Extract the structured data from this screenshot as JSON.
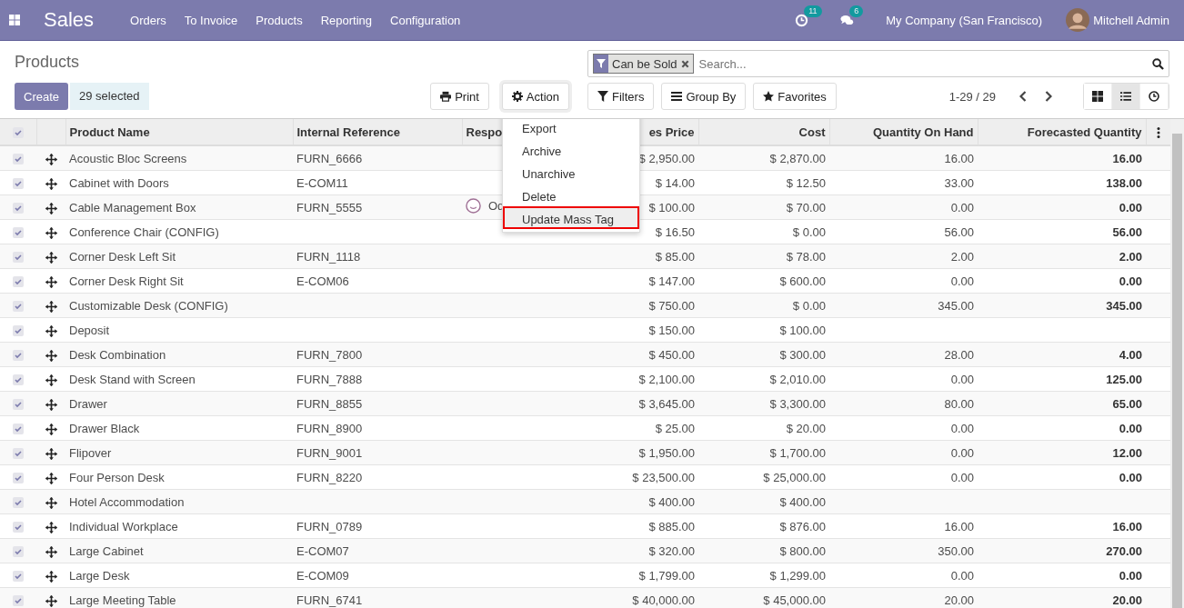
{
  "navbar": {
    "app": "Sales",
    "menu": [
      "Orders",
      "To Invoice",
      "Products",
      "Reporting",
      "Configuration"
    ],
    "activity_count": "11",
    "message_count": "6",
    "company": "My Company (San Francisco)",
    "user": "Mitchell Admin"
  },
  "control_panel": {
    "title": "Products",
    "create": "Create",
    "selection": "29 selected",
    "print": "Print",
    "action": "Action",
    "facet": {
      "label": "Can be Sold"
    },
    "search": {
      "placeholder": "Search..."
    },
    "filters": "Filters",
    "group_by": "Group By",
    "favorites": "Favorites",
    "pager": "1-29 / 29",
    "views": [
      {
        "kind": "kanban",
        "selected": false
      },
      {
        "kind": "list",
        "selected": true
      },
      {
        "kind": "activity",
        "selected": false
      }
    ]
  },
  "action_menu": [
    {
      "label": "Export",
      "selected": false
    },
    {
      "label": "Archive",
      "selected": false
    },
    {
      "label": "Unarchive",
      "selected": false
    },
    {
      "label": "Delete",
      "selected": false
    },
    {
      "label": "Update Mass Tag",
      "selected": true
    }
  ],
  "table": {
    "all_checked": true,
    "columns": [
      "Product Name",
      "Internal Reference",
      "Respo",
      "es Price",
      "Cost",
      "Quantity On Hand",
      "Forecasted Quantity"
    ],
    "rows": [
      {
        "checked": true,
        "name": "Acoustic Bloc Screens",
        "ref": "FURN_6666",
        "price": "$ 2,950.00",
        "cost": "$ 2,870.00",
        "on_hand": "16.00",
        "forecast": "16.00"
      },
      {
        "checked": true,
        "name": "Cabinet with Doors",
        "ref": "E-COM11",
        "price": "$ 14.00",
        "cost": "$ 12.50",
        "on_hand": "33.00",
        "forecast": "138.00"
      },
      {
        "checked": true,
        "name": "Cable Management Box",
        "ref": "FURN_5555",
        "responsible": "Od",
        "price": "$ 100.00",
        "cost": "$ 70.00",
        "on_hand": "0.00",
        "forecast": "0.00"
      },
      {
        "checked": true,
        "name": "Conference Chair (CONFIG)",
        "price": "$ 16.50",
        "cost": "$ 0.00",
        "on_hand": "56.00",
        "forecast": "56.00"
      },
      {
        "checked": true,
        "name": "Corner Desk Left Sit",
        "ref": "FURN_1118",
        "price": "$ 85.00",
        "cost": "$ 78.00",
        "on_hand": "2.00",
        "forecast": "2.00"
      },
      {
        "checked": true,
        "name": "Corner Desk Right Sit",
        "ref": "E-COM06",
        "price": "$ 147.00",
        "cost": "$ 600.00",
        "on_hand": "0.00",
        "forecast": "0.00"
      },
      {
        "checked": true,
        "name": "Customizable Desk (CONFIG)",
        "price": "$ 750.00",
        "cost": "$ 0.00",
        "on_hand": "345.00",
        "forecast": "345.00"
      },
      {
        "checked": true,
        "name": "Deposit",
        "price": "$ 150.00",
        "cost": "$ 100.00"
      },
      {
        "checked": true,
        "name": "Desk Combination",
        "ref": "FURN_7800",
        "price": "$ 450.00",
        "cost": "$ 300.00",
        "on_hand": "28.00",
        "forecast": "4.00"
      },
      {
        "checked": true,
        "name": "Desk Stand with Screen",
        "ref": "FURN_7888",
        "price": "$ 2,100.00",
        "cost": "$ 2,010.00",
        "on_hand": "0.00",
        "forecast": "125.00"
      },
      {
        "checked": true,
        "name": "Drawer",
        "ref": "FURN_8855",
        "price": "$ 3,645.00",
        "cost": "$ 3,300.00",
        "on_hand": "80.00",
        "forecast": "65.00"
      },
      {
        "checked": true,
        "name": "Drawer Black",
        "ref": "FURN_8900",
        "price": "$ 25.00",
        "cost": "$ 20.00",
        "on_hand": "0.00",
        "forecast": "0.00"
      },
      {
        "checked": true,
        "name": "Flipover",
        "ref": "FURN_9001",
        "price": "$ 1,950.00",
        "cost": "$ 1,700.00",
        "on_hand": "0.00",
        "forecast": "12.00"
      },
      {
        "checked": true,
        "name": "Four Person Desk",
        "ref": "FURN_8220",
        "price": "$ 23,500.00",
        "cost": "$ 25,000.00",
        "on_hand": "0.00",
        "forecast": "0.00"
      },
      {
        "checked": true,
        "name": "Hotel Accommodation",
        "price": "$ 400.00",
        "cost": "$ 400.00"
      },
      {
        "checked": true,
        "name": "Individual Workplace",
        "ref": "FURN_0789",
        "price": "$ 885.00",
        "cost": "$ 876.00",
        "on_hand": "16.00",
        "forecast": "16.00"
      },
      {
        "checked": true,
        "name": "Large Cabinet",
        "ref": "E-COM07",
        "price": "$ 320.00",
        "cost": "$ 800.00",
        "on_hand": "350.00",
        "forecast": "270.00"
      },
      {
        "checked": true,
        "name": "Large Desk",
        "ref": "E-COM09",
        "price": "$ 1,799.00",
        "cost": "$ 1,299.00",
        "on_hand": "0.00",
        "forecast": "0.00"
      },
      {
        "checked": true,
        "name": "Large Meeting Table",
        "ref": "FURN_6741",
        "price": "$ 40,000.00",
        "cost": "$ 45,000.00",
        "on_hand": "20.00",
        "forecast": "20.00"
      }
    ]
  }
}
